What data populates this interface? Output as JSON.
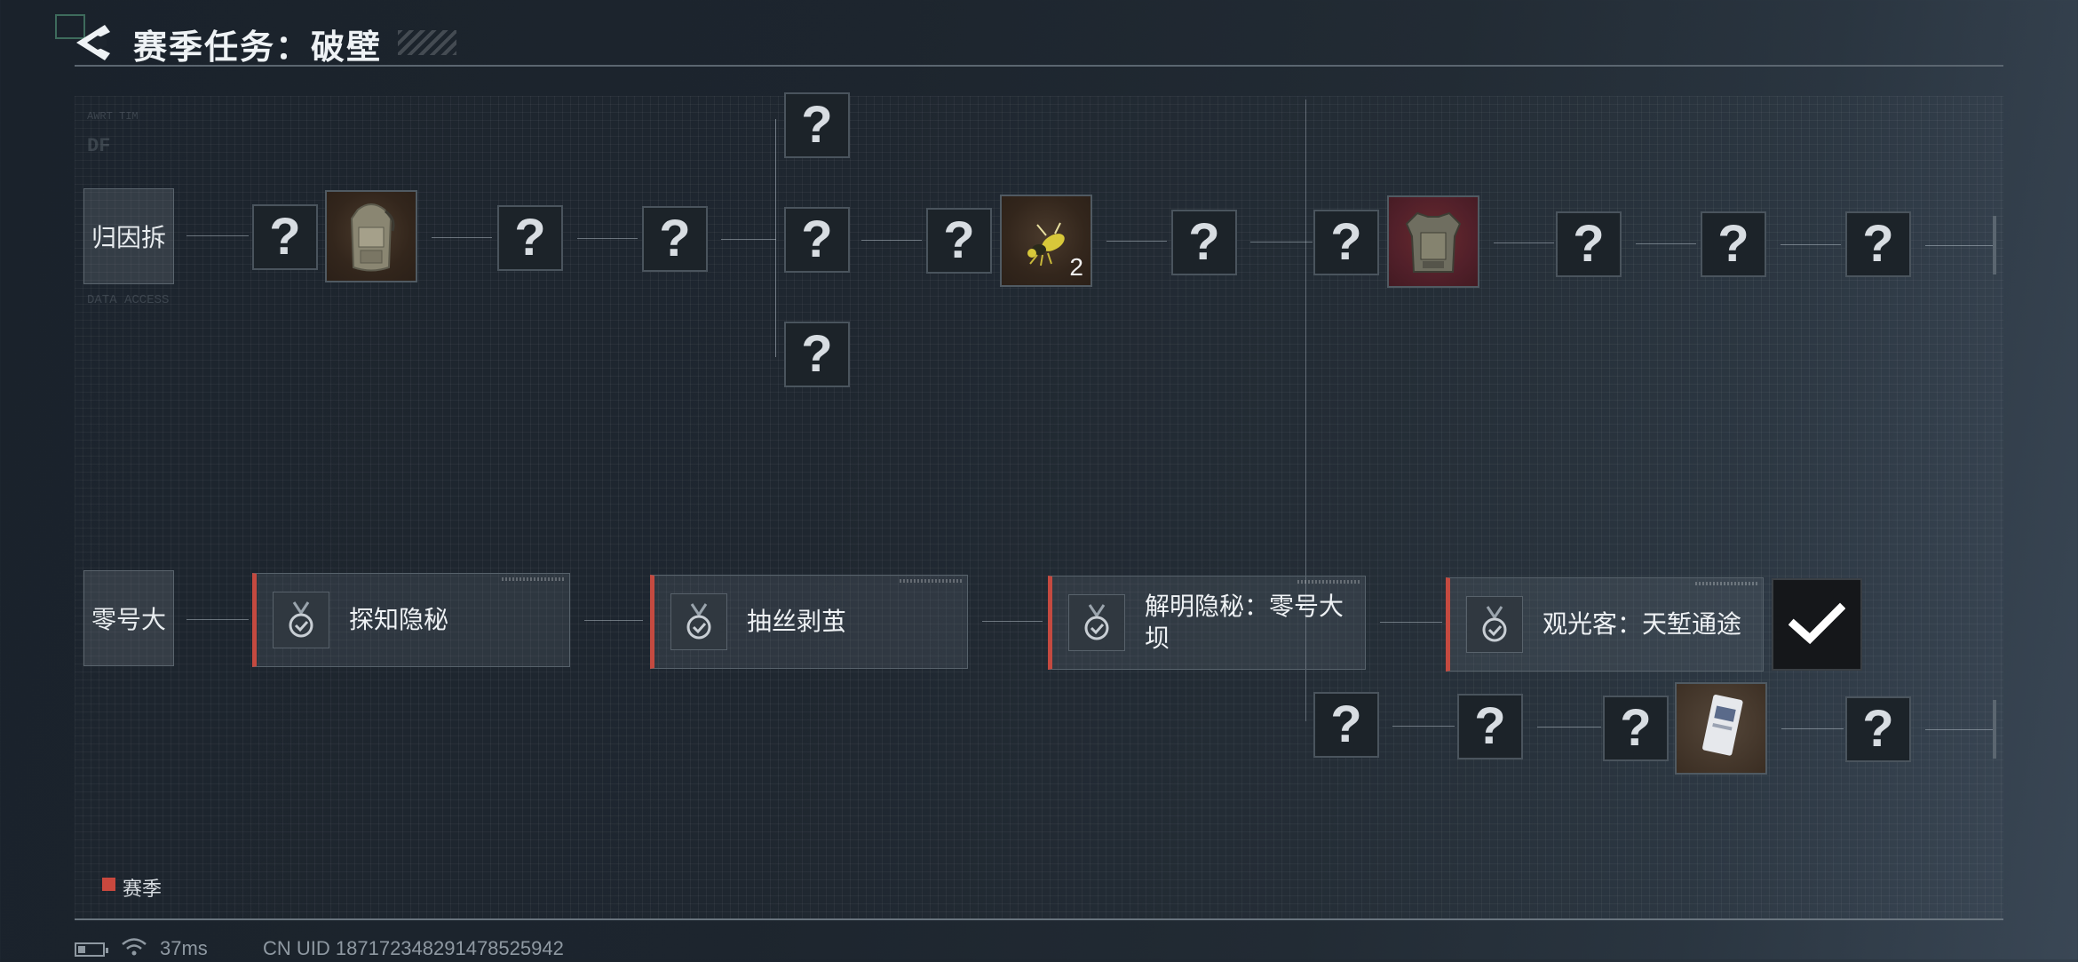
{
  "header": {
    "title": "赛季任务：破壁",
    "back_icon": "chevron-left-icon"
  },
  "top_row": {
    "start_label": "归因拆",
    "unknown_glyph": "?",
    "item_count": "2",
    "items": [
      "backpack",
      "wasp",
      "armor-vest"
    ]
  },
  "bottom_row": {
    "start_label": "零号大",
    "tasks": [
      {
        "label": "探知隐秘"
      },
      {
        "label": "抽丝剥茧"
      },
      {
        "label": "解明隐秘：零号大坝"
      },
      {
        "label": "观光客：天堑通途"
      }
    ]
  },
  "legend": {
    "label": "赛季",
    "color": "#c8483e"
  },
  "status_bar": {
    "ping": "37ms",
    "uid": "CN UID 18717234829147852​5942"
  },
  "background_text": {
    "code": "DF",
    "line1": "AWRT TIM",
    "line2": "DATA ACCESS"
  }
}
